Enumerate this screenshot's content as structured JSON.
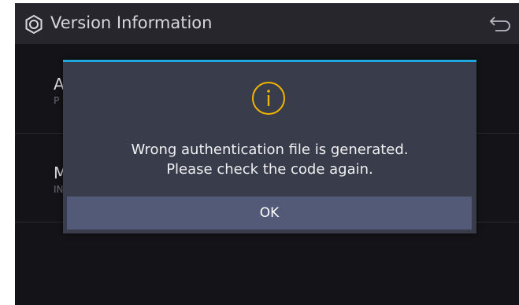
{
  "header": {
    "title": "Version Information",
    "settings_icon": "gear-icon",
    "back_icon": "back-arrow-icon"
  },
  "list": {
    "items": [
      {
        "title": "A",
        "subtitle": "P"
      },
      {
        "title": "M",
        "subtitle": "IN"
      }
    ]
  },
  "dialog": {
    "icon": "info-icon",
    "accent_color": "#1ea8dc",
    "icon_color": "#f0b400",
    "message_line1": "Wrong authentication file is generated.",
    "message_line2": "Please check the code again.",
    "ok_label": "OK"
  }
}
